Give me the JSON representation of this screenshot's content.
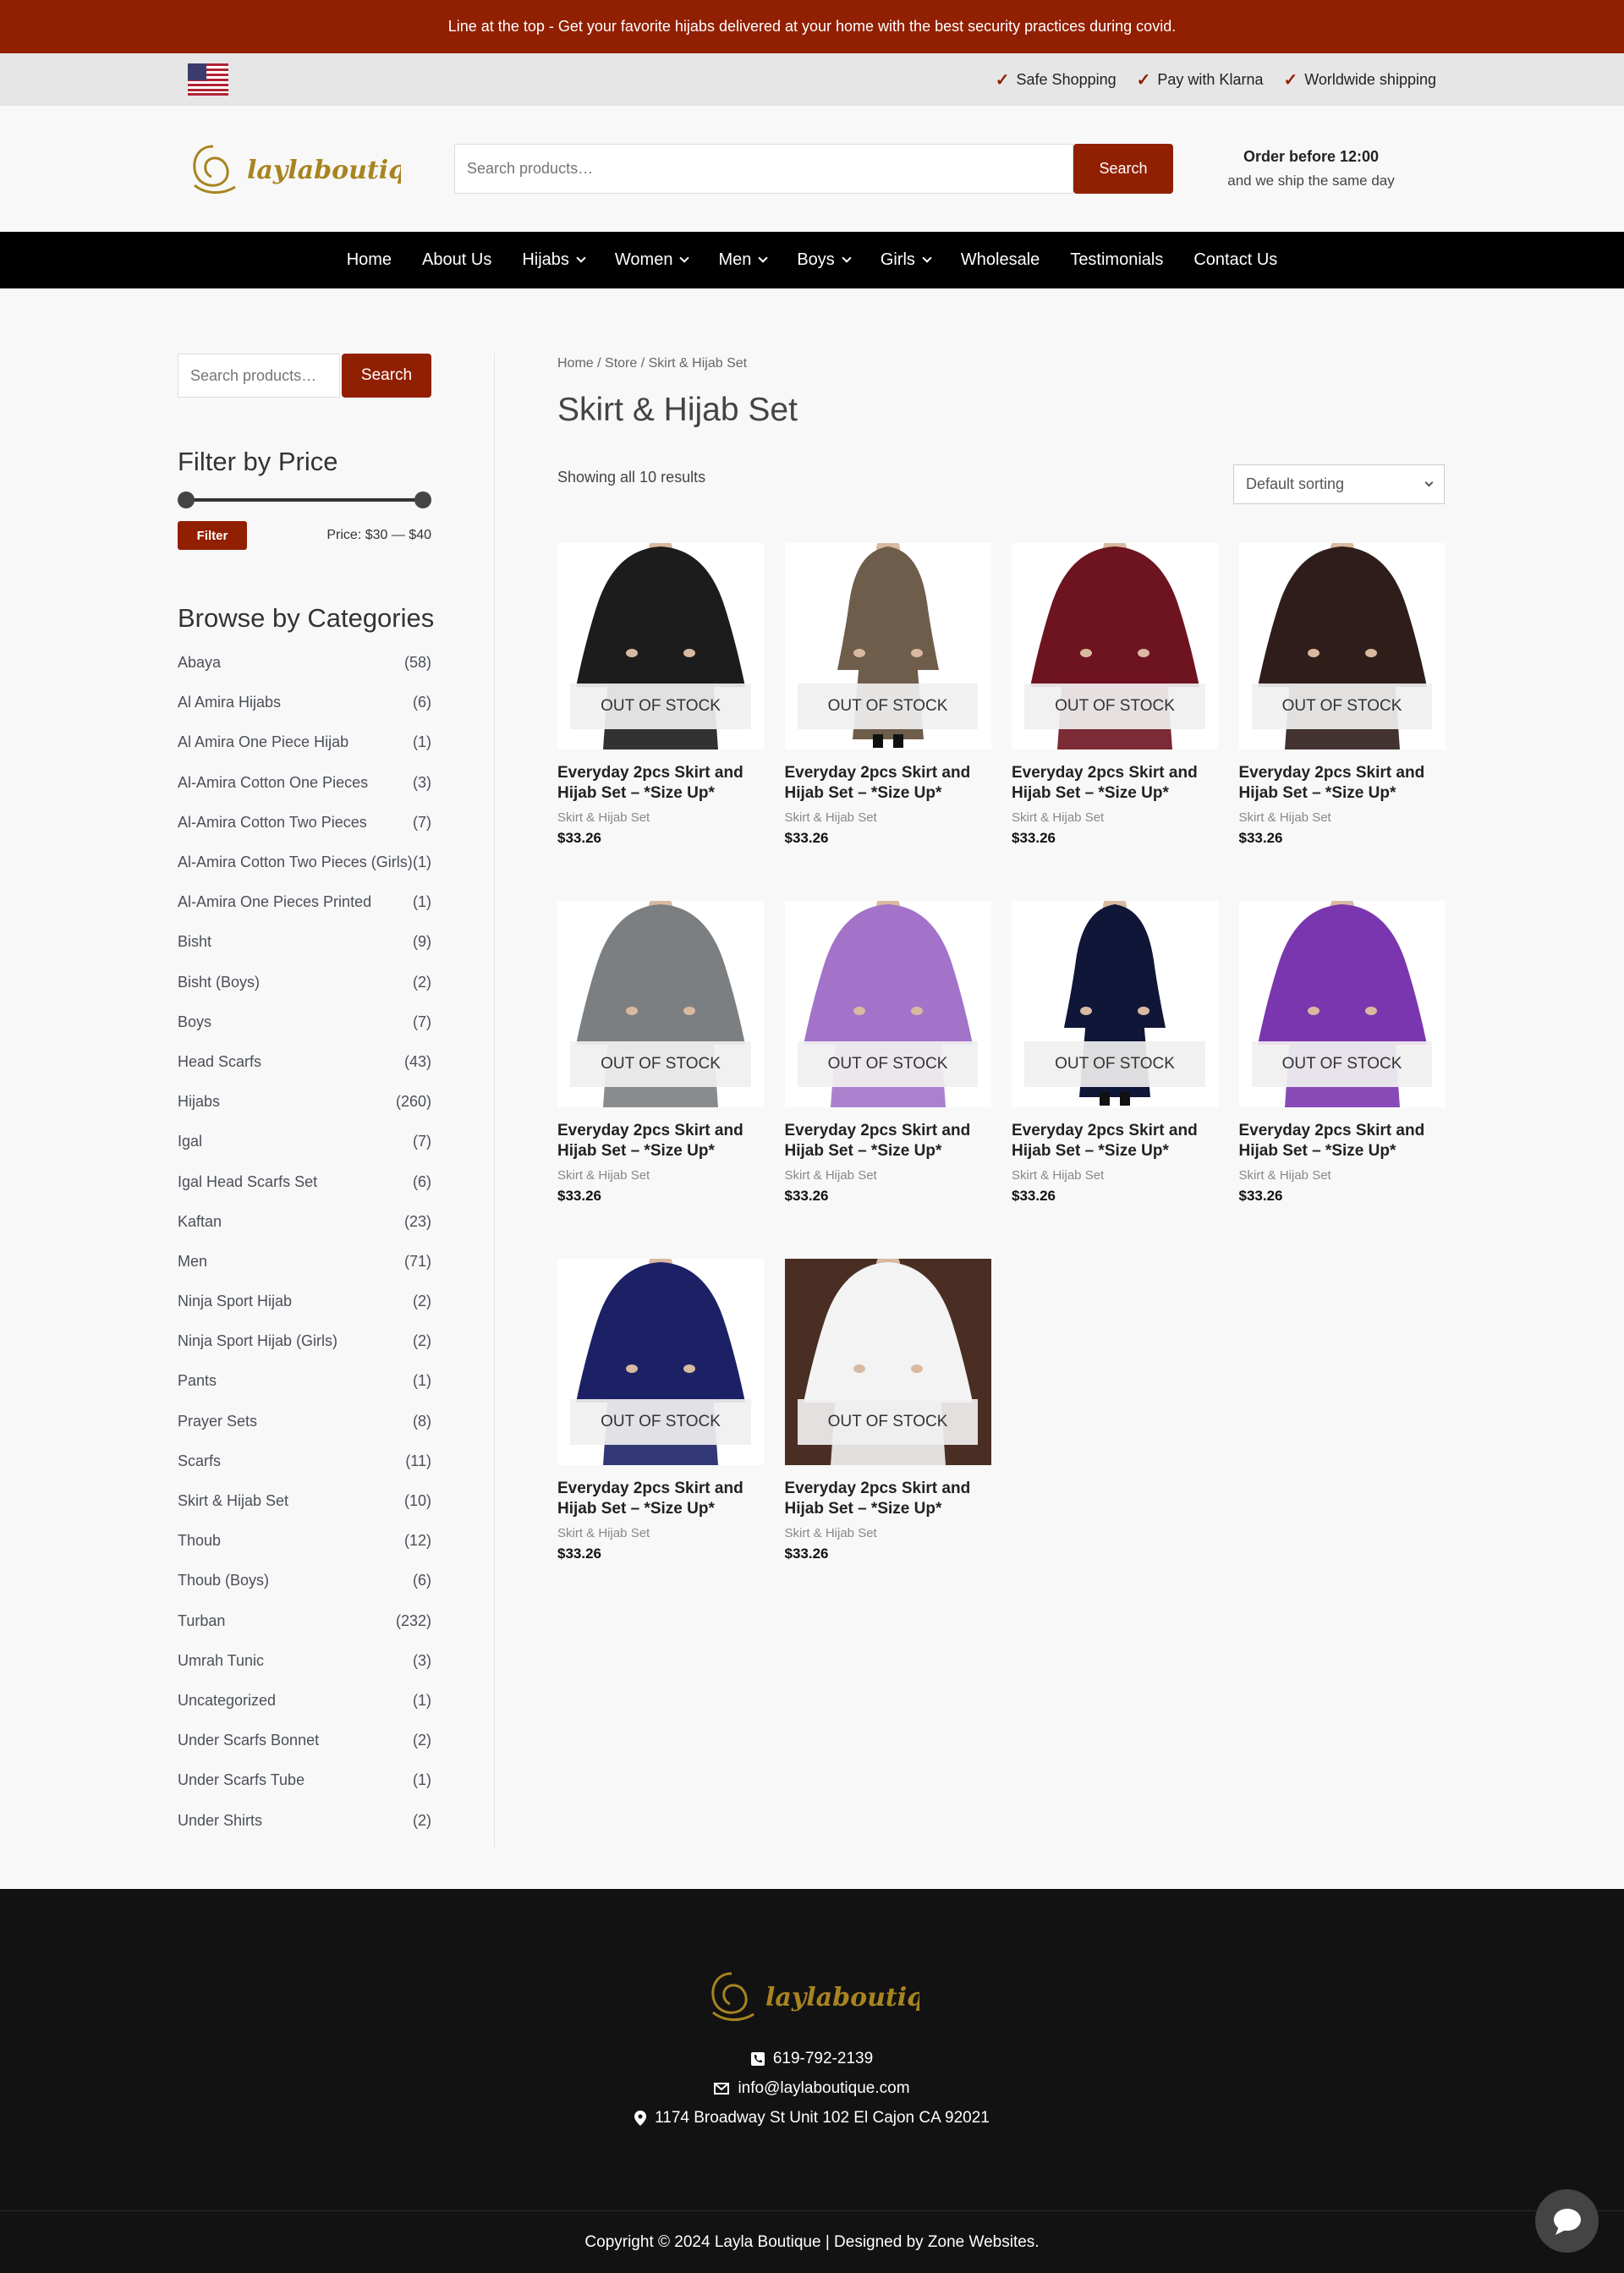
{
  "topbar": {
    "announcement": "Line at the top - Get your favorite hijabs delivered at your home with the best security practices during covid."
  },
  "infobar": {
    "flag_icon": "us-flag-icon",
    "items": [
      {
        "icon": "check-icon",
        "label": "Safe Shopping"
      },
      {
        "icon": "check-icon",
        "label": "Pay with Klarna"
      },
      {
        "icon": "check-icon",
        "label": "Worldwide shipping"
      }
    ]
  },
  "header": {
    "logo_text": "laylaboutiquë",
    "search_placeholder": "Search products…",
    "search_button": "Search",
    "order_title": "Order before 12:00",
    "order_sub": "and we ship the same day"
  },
  "nav": {
    "items": [
      {
        "label": "Home",
        "dropdown": false
      },
      {
        "label": "About Us",
        "dropdown": false
      },
      {
        "label": "Hijabs",
        "dropdown": true
      },
      {
        "label": "Women",
        "dropdown": true
      },
      {
        "label": "Men",
        "dropdown": true
      },
      {
        "label": "Boys",
        "dropdown": true
      },
      {
        "label": "Girls",
        "dropdown": true
      },
      {
        "label": "Wholesale",
        "dropdown": false
      },
      {
        "label": "Testimonials",
        "dropdown": false
      },
      {
        "label": "Contact Us",
        "dropdown": false
      }
    ]
  },
  "sidebar": {
    "search_placeholder": "Search products…",
    "search_button": "Search",
    "filter_title": "Filter by Price",
    "filter_button": "Filter",
    "price_label": "Price: $30 — $40",
    "categories_title": "Browse by Categories",
    "categories": [
      {
        "name": "Abaya",
        "count": "(58)"
      },
      {
        "name": "Al Amira Hijabs",
        "count": "(6)"
      },
      {
        "name": "Al Amira One Piece Hijab",
        "count": "(1)"
      },
      {
        "name": "Al-Amira Cotton One Pieces",
        "count": "(3)"
      },
      {
        "name": "Al-Amira Cotton Two Pieces",
        "count": "(7)"
      },
      {
        "name": "Al-Amira Cotton Two Pieces (Girls)",
        "count": "(1)"
      },
      {
        "name": "Al-Amira One Pieces Printed",
        "count": "(1)"
      },
      {
        "name": "Bisht",
        "count": "(9)"
      },
      {
        "name": "Bisht (Boys)",
        "count": "(2)"
      },
      {
        "name": "Boys",
        "count": "(7)"
      },
      {
        "name": "Head Scarfs",
        "count": "(43)"
      },
      {
        "name": "Hijabs",
        "count": "(260)"
      },
      {
        "name": "Igal",
        "count": "(7)"
      },
      {
        "name": "Igal Head Scarfs Set",
        "count": "(6)"
      },
      {
        "name": "Kaftan",
        "count": "(23)"
      },
      {
        "name": "Men",
        "count": "(71)"
      },
      {
        "name": "Ninja Sport Hijab",
        "count": "(2)"
      },
      {
        "name": "Ninja Sport Hijab (Girls)",
        "count": "(2)"
      },
      {
        "name": "Pants",
        "count": "(1)"
      },
      {
        "name": "Prayer Sets",
        "count": "(8)"
      },
      {
        "name": "Scarfs",
        "count": "(11)"
      },
      {
        "name": "Skirt & Hijab Set",
        "count": "(10)"
      },
      {
        "name": "Thoub",
        "count": "(12)"
      },
      {
        "name": "Thoub (Boys)",
        "count": "(6)"
      },
      {
        "name": "Turban",
        "count": "(232)"
      },
      {
        "name": "Umrah Tunic",
        "count": "(3)"
      },
      {
        "name": "Uncategorized",
        "count": "(1)"
      },
      {
        "name": "Under Scarfs Bonnet",
        "count": "(2)"
      },
      {
        "name": "Under Scarfs Tube",
        "count": "(1)"
      },
      {
        "name": "Under Shirts",
        "count": "(2)"
      }
    ]
  },
  "main": {
    "breadcrumb": "Home / Store / Skirt & Hijab Set",
    "title": "Skirt & Hijab Set",
    "result_count": "Showing all 10 results",
    "sort_value": "Default sorting",
    "products": [
      {
        "title": "Everyday 2pcs Skirt and Hijab Set – *Size Up*",
        "category": "Skirt & Hijab Set",
        "price": "$33.26",
        "badge": "OUT OF STOCK",
        "color": "#1c1c1c",
        "bg": "#ffffff",
        "style": "full"
      },
      {
        "title": "Everyday 2pcs Skirt and Hijab Set – *Size Up*",
        "category": "Skirt & Hijab Set",
        "price": "$33.26",
        "badge": "OUT OF STOCK",
        "color": "#6f5d4b",
        "bg": "#ffffff",
        "style": "narrow"
      },
      {
        "title": "Everyday 2pcs Skirt and Hijab Set – *Size Up*",
        "category": "Skirt & Hijab Set",
        "price": "$33.26",
        "badge": "OUT OF STOCK",
        "color": "#6e1320",
        "bg": "#ffffff",
        "style": "full"
      },
      {
        "title": "Everyday 2pcs Skirt and Hijab Set – *Size Up*",
        "category": "Skirt & Hijab Set",
        "price": "$33.26",
        "badge": "OUT OF STOCK",
        "color": "#2e1d1a",
        "bg": "#ffffff",
        "style": "full"
      },
      {
        "title": "Everyday 2pcs Skirt and Hijab Set – *Size Up*",
        "category": "Skirt & Hijab Set",
        "price": "$33.26",
        "badge": "OUT OF STOCK",
        "color": "#7c7f82",
        "bg": "#ffffff",
        "style": "full"
      },
      {
        "title": "Everyday 2pcs Skirt and Hijab Set – *Size Up*",
        "category": "Skirt & Hijab Set",
        "price": "$33.26",
        "badge": "OUT OF STOCK",
        "color": "#a273c9",
        "bg": "#ffffff",
        "style": "full"
      },
      {
        "title": "Everyday 2pcs Skirt and Hijab Set – *Size Up*",
        "category": "Skirt & Hijab Set",
        "price": "$33.26",
        "badge": "OUT OF STOCK",
        "color": "#0f1638",
        "bg": "#ffffff",
        "style": "narrow"
      },
      {
        "title": "Everyday 2pcs Skirt and Hijab Set – *Size Up*",
        "category": "Skirt & Hijab Set",
        "price": "$33.26",
        "badge": "OUT OF STOCK",
        "color": "#7a36ae",
        "bg": "#ffffff",
        "style": "full"
      },
      {
        "title": "Everyday 2pcs Skirt and Hijab Set – *Size Up*",
        "category": "Skirt & Hijab Set",
        "price": "$33.26",
        "badge": "OUT OF STOCK",
        "color": "#1c2166",
        "bg": "#ffffff",
        "style": "full"
      },
      {
        "title": "Everyday 2pcs Skirt and Hijab Set – *Size Up*",
        "category": "Skirt & Hijab Set",
        "price": "$33.26",
        "badge": "OUT OF STOCK",
        "color": "#f3f3f3",
        "bg": "#4a2e24",
        "style": "full"
      }
    ]
  },
  "footer": {
    "logo_text": "laylaboutiquë",
    "phone": "619-792-2139",
    "email": "info@laylaboutique.com",
    "address": "1174 Broadway St Unit 102 El Cajon CA 92021",
    "copyright": "Copyright © 2024 Layla Boutique | Designed by Zone Websites."
  },
  "chat": {
    "icon": "chat-bubble-icon"
  },
  "colors": {
    "accent": "#911f02",
    "logo_gold": "#a88420",
    "nav_bg": "#000000",
    "footer_bg": "#121212"
  }
}
